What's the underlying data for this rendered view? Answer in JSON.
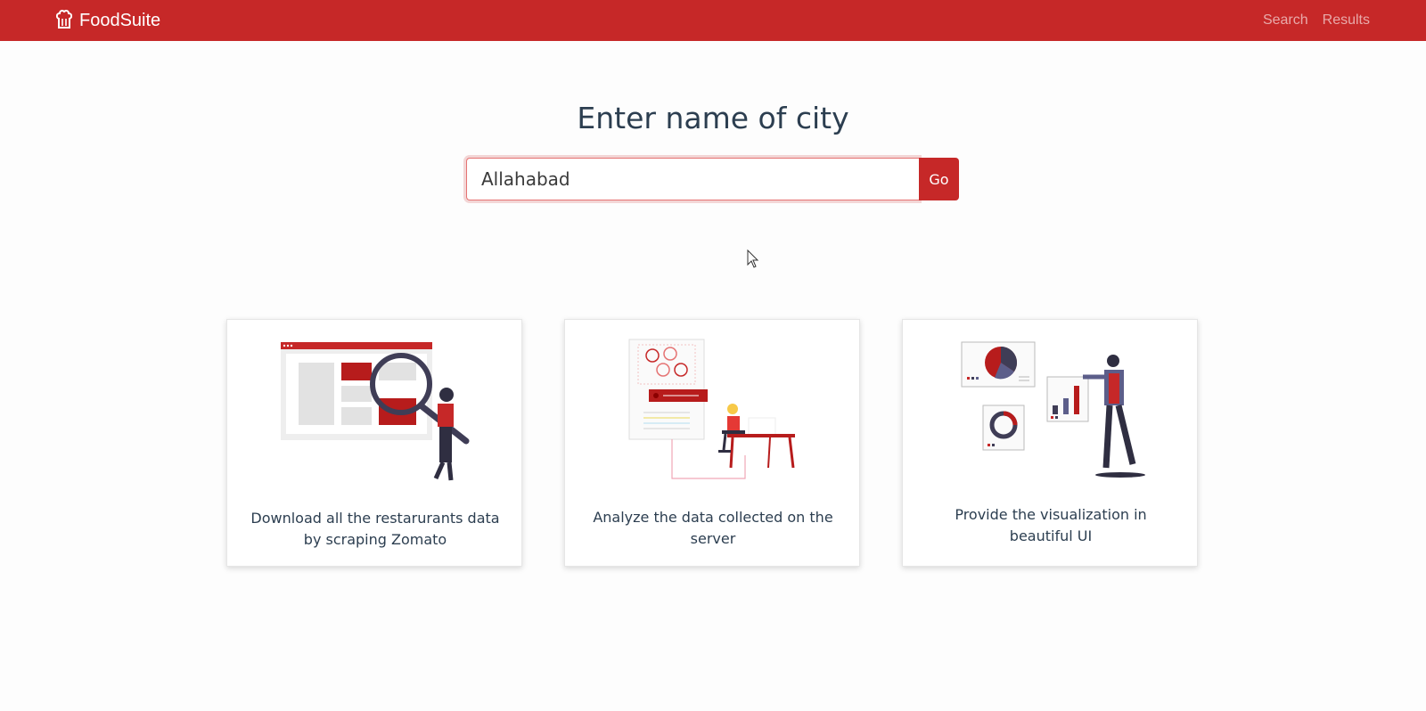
{
  "header": {
    "brand": "FoodSuite",
    "brand_icon": "chef-hat-icon",
    "nav": [
      {
        "label": "Search"
      },
      {
        "label": "Results"
      }
    ],
    "colors": {
      "primary": "#c62828"
    }
  },
  "main": {
    "title": "Enter name of city",
    "search": {
      "value": "Allahabad",
      "button_label": "Go"
    }
  },
  "cards": [
    {
      "icon": "search-illustration-icon",
      "text": "Download all the restarurants data by scraping Zomato"
    },
    {
      "icon": "analysis-illustration-icon",
      "text": "Analyze the data collected on the server"
    },
    {
      "icon": "visualization-illustration-icon",
      "text": "Provide the visualization in beautiful UI"
    }
  ]
}
